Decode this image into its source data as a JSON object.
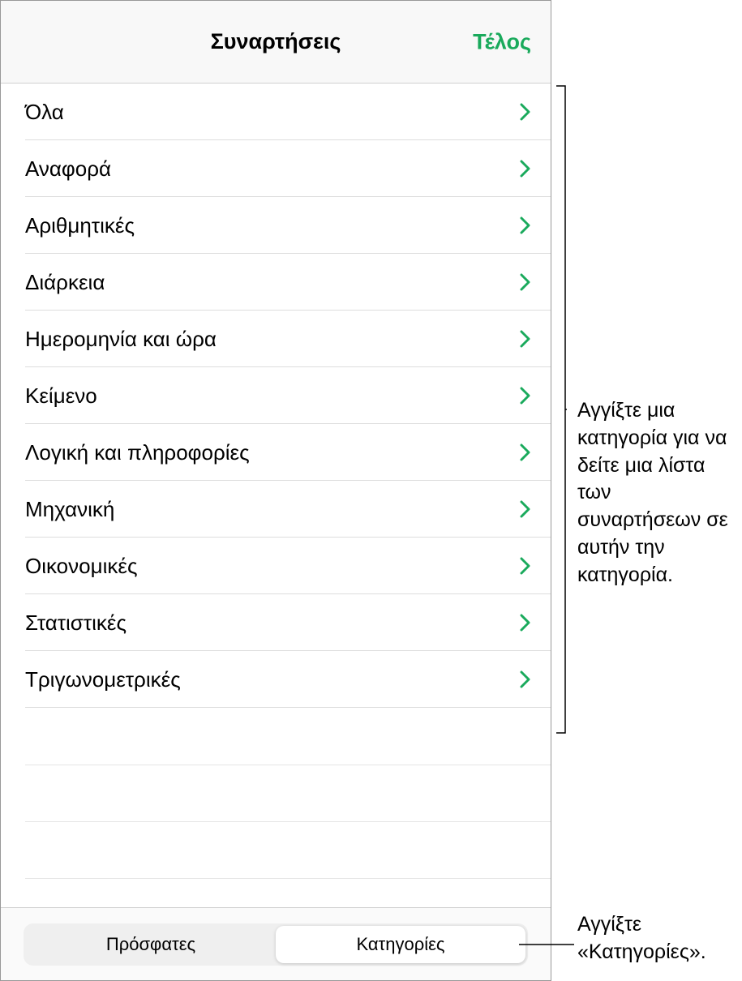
{
  "header": {
    "title": "Συναρτήσεις",
    "done_label": "Τέλος"
  },
  "categories": [
    {
      "label": "Όλα"
    },
    {
      "label": "Αναφορά"
    },
    {
      "label": "Αριθμητικές"
    },
    {
      "label": "Διάρκεια"
    },
    {
      "label": "Ημερομηνία και ώρα"
    },
    {
      "label": "Κείμενο"
    },
    {
      "label": "Λογική και πληροφορίες"
    },
    {
      "label": "Μηχανική"
    },
    {
      "label": "Οικονομικές"
    },
    {
      "label": "Στατιστικές"
    },
    {
      "label": "Τριγωνομετρικές"
    }
  ],
  "footer": {
    "recent_label": "Πρόσφατες",
    "categories_label": "Κατηγορίες"
  },
  "callouts": {
    "c1": "Αγγίξτε μια κατηγορία για να δείτε μια λίστα των συναρτήσεων σε αυτήν την κατηγορία.",
    "c2": "Αγγίξτε «Κατηγορίες»."
  },
  "colors": {
    "accent": "#1aaa5c"
  }
}
